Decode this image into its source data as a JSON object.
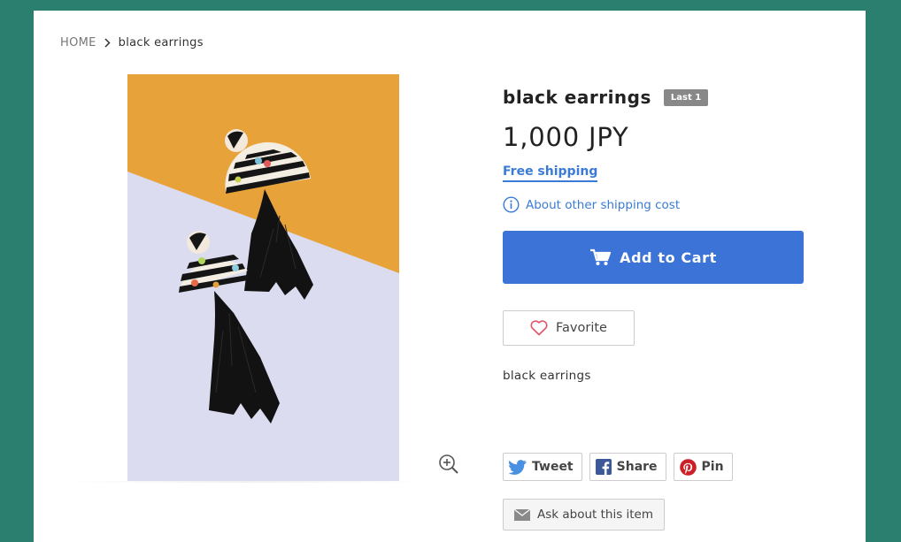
{
  "breadcrumb": {
    "home": "HOME",
    "current": "black earrings"
  },
  "product": {
    "title": "black earrings",
    "stock_badge": "Last 1",
    "price": "1,000 JPY",
    "free_shipping": "Free shipping",
    "shipping_cost_link": "About other shipping cost",
    "add_to_cart": "Add to Cart",
    "favorite": "Favorite",
    "description": "black earrings"
  },
  "share": {
    "tweet": "Tweet",
    "share": "Share",
    "pin": "Pin"
  },
  "contact": {
    "ask": "Ask about this item"
  },
  "icons": {
    "breadcrumb_sep": "chevron-right-icon",
    "zoom": "zoom-in-icon",
    "info": "info-icon",
    "cart": "cart-icon",
    "favorite": "heart-icon",
    "tweet": "twitter-icon",
    "share": "facebook-icon",
    "pin": "pinterest-icon",
    "ask": "mail-icon"
  },
  "colors": {
    "background": "#2a7f6e",
    "accent_blue": "#3b73d6",
    "link_blue": "#3a7bd5",
    "badge_gray": "#888888",
    "photo_orange": "#e8a23a",
    "photo_lavender": "#dcdcf0"
  }
}
